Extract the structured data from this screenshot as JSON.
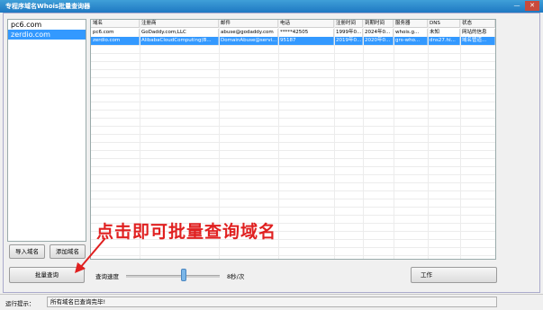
{
  "window": {
    "title": "专程序域名Whois批量查询器",
    "minimize_glyph": "—",
    "close_glyph": "✕"
  },
  "domain_list": [
    "pc6.com",
    "zerdio.com"
  ],
  "table": {
    "columns": [
      "域名",
      "注册商",
      "邮件",
      "电话",
      "注册时间",
      "到期时间",
      "服务器",
      "DNS",
      "状态"
    ],
    "rows": [
      [
        "pc6.com",
        "GoDaddy.com,LLC",
        "abuse@godaddy.com",
        "*****42505",
        "1999年0...",
        "2024年0...",
        "whois.g...",
        "未知",
        "网站的信息"
      ],
      [
        "zerdio.com",
        "AlibabaCloudComputing(B...",
        "DomainAbuse@servi...",
        "95187",
        "2019年0...",
        "2020年0...",
        "grs-who...",
        "dns27.hi...",
        "域名管道..."
      ]
    ]
  },
  "buttons": {
    "import": "导入域名",
    "add": "添加域名",
    "batch": "批量查询",
    "work": "工作"
  },
  "speed": {
    "label": "查询速度",
    "value_text": "8秒/次",
    "level": 0.62
  },
  "annotation": {
    "text": "点击即可批量查询域名",
    "color": "#e02020"
  },
  "status": {
    "label": "运行提示：",
    "message": "所有域名已查询完毕!"
  },
  "colors": {
    "selection": "#3399ff",
    "titlebar": "#1e78c2"
  },
  "icons": [
    "minimize-icon",
    "close-icon",
    "arrow-icon"
  ]
}
